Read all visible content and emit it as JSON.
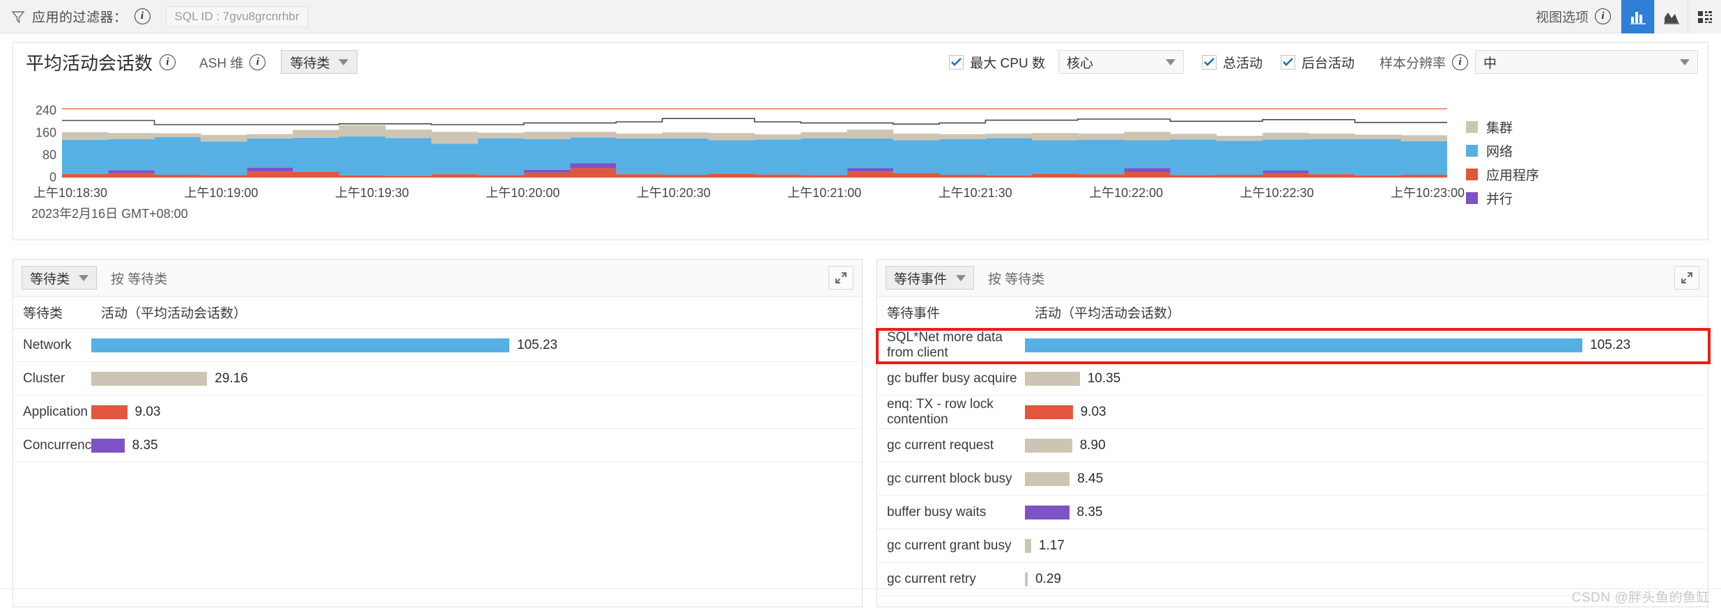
{
  "topbar": {
    "filter_icon": "funnel-icon",
    "filter_label": "应用的过滤器：",
    "info_glyph": "i",
    "sql_id": "SQL ID : 7gvu8grcnrhbr",
    "view_options_label": "视图选项",
    "view_buttons": [
      {
        "name": "bar-chart-view",
        "active": true
      },
      {
        "name": "area-chart-view",
        "active": false
      },
      {
        "name": "grid-view",
        "active": false
      }
    ]
  },
  "chart_panel": {
    "title": "平均活动会话数",
    "ash_label": "ASH 维",
    "dimension_dropdown": "等待类",
    "max_cpu_label": "最大 CPU 数",
    "max_cpu_checked": true,
    "max_cpu_select": "核心",
    "total_activity_label": "总活动",
    "total_activity_checked": true,
    "background_activity_label": "后台活动",
    "background_activity_checked": true,
    "resolution_label": "样本分辨率",
    "resolution_value": "中",
    "date_footer": "2023年2月16日 GMT+08:00"
  },
  "chart_data": {
    "type": "area",
    "title": "平均活动会话数",
    "xlabel": "",
    "ylabel": "",
    "ylim": [
      0,
      280
    ],
    "yticks": [
      0,
      80,
      160,
      240
    ],
    "grid": false,
    "legend_position": "right",
    "x_tick_labels": [
      "上午10:18:30",
      "上午10:19:00",
      "上午10:19:30",
      "上午10:20:00",
      "上午10:20:30",
      "上午10:21:00",
      "上午10:21:30",
      "上午10:22:00",
      "上午10:22:30",
      "上午10:23:00"
    ],
    "series": [
      {
        "name": "应用程序",
        "color": "#e0573e",
        "values": [
          13,
          16,
          10,
          9,
          22,
          21,
          8,
          6,
          12,
          9,
          18,
          34,
          12,
          10,
          14,
          11,
          9,
          22,
          16,
          10,
          8,
          14,
          12,
          20,
          9,
          10,
          16,
          12,
          8,
          10
        ]
      },
      {
        "name": "并行",
        "color": "#7d52c4",
        "values": [
          0,
          10,
          0,
          0,
          14,
          0,
          0,
          0,
          0,
          0,
          10,
          18,
          0,
          0,
          0,
          0,
          0,
          12,
          0,
          0,
          0,
          0,
          0,
          14,
          0,
          0,
          9,
          0,
          0,
          0
        ]
      },
      {
        "name": "网络",
        "color": "#57b0e4",
        "values": [
          122,
          112,
          135,
          120,
          104,
          122,
          140,
          136,
          110,
          132,
          110,
          92,
          128,
          130,
          120,
          126,
          132,
          106,
          118,
          128,
          134,
          120,
          124,
          100,
          128,
          122,
          112,
          126,
          130,
          120
        ]
      },
      {
        "name": "集群",
        "color": "#cdc5b4",
        "values": [
          28,
          22,
          14,
          24,
          16,
          28,
          40,
          30,
          42,
          20,
          26,
          20,
          18,
          22,
          26,
          18,
          22,
          32,
          24,
          18,
          16,
          26,
          22,
          30,
          20,
          18,
          24,
          20,
          16,
          22
        ]
      }
    ],
    "reference_lines": [
      {
        "name": "最大 CPU 数",
        "color": "#f08a75",
        "value": 247
      },
      {
        "name": "总活动",
        "color": "#4a4a4a",
        "values": [
          205,
          205,
          190,
          190,
          190,
          190,
          193,
          193,
          190,
          190,
          196,
          196,
          200,
          212,
          212,
          200,
          196,
          196,
          192,
          196,
          206,
          206,
          210,
          210,
          202,
          202,
          208,
          208,
          198,
          198
        ]
      }
    ],
    "legend": [
      {
        "label": "集群",
        "color": "#cdc5b4"
      },
      {
        "label": "网络",
        "color": "#57b0e4"
      },
      {
        "label": "应用程序",
        "color": "#e0573e"
      },
      {
        "label": "并行",
        "color": "#7d52c4"
      }
    ]
  },
  "left_panel": {
    "dropdown": "等待类",
    "by_label": "按 等待类",
    "columns": [
      "等待类",
      "活动（平均活动会话数）"
    ],
    "max_value": 105.23,
    "rows": [
      {
        "label": "Network",
        "value": "105.23",
        "num": 105.23,
        "color": "#57b0e4"
      },
      {
        "label": "Cluster",
        "value": "29.16",
        "num": 29.16,
        "color": "#cdc5b4"
      },
      {
        "label": "Application",
        "value": "9.03",
        "num": 9.03,
        "color": "#e0573e"
      },
      {
        "label": "Concurrency",
        "value": "8.35",
        "num": 8.35,
        "color": "#7d52c4"
      }
    ]
  },
  "right_panel": {
    "dropdown": "等待事件",
    "by_label": "按 等待类",
    "columns": [
      "等待事件",
      "活动（平均活动会话数）"
    ],
    "max_value": 105.23,
    "highlight_color": "#ee1c10",
    "rows": [
      {
        "label": "SQL*Net more data from client",
        "value": "105.23",
        "num": 105.23,
        "color": "#57b0e4",
        "highlighted": true
      },
      {
        "label": "gc buffer busy acquire",
        "value": "10.35",
        "num": 10.35,
        "color": "#cdc5b4",
        "highlighted": false
      },
      {
        "label": "enq: TX - row lock contention",
        "value": "9.03",
        "num": 9.03,
        "color": "#e0573e",
        "highlighted": false
      },
      {
        "label": "gc current request",
        "value": "8.90",
        "num": 8.9,
        "color": "#cdc5b4",
        "highlighted": false
      },
      {
        "label": "gc current block busy",
        "value": "8.45",
        "num": 8.45,
        "color": "#cdc5b4",
        "highlighted": false
      },
      {
        "label": "buffer busy waits",
        "value": "8.35",
        "num": 8.35,
        "color": "#7d52c4",
        "highlighted": false
      },
      {
        "label": "gc current grant busy",
        "value": "1.17",
        "num": 1.17,
        "color": "#cdc5b4",
        "highlighted": false
      },
      {
        "label": "gc current retry",
        "value": "0.29",
        "num": 0.29,
        "color": "#cdc5b4",
        "highlighted": false
      }
    ]
  },
  "watermark": "CSDN @胖头鱼的鱼缸"
}
